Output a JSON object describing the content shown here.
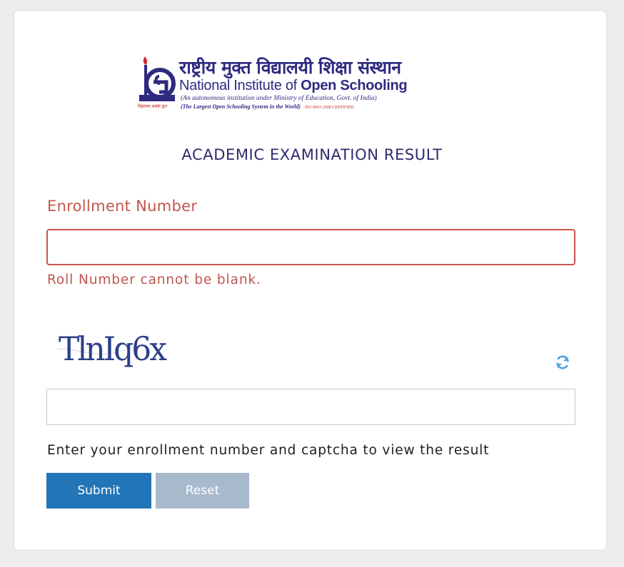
{
  "logo": {
    "title_hindi": "राष्ट्रीय मुक्त विद्यालयी शिक्षा संस्थान",
    "title_english_regular": "National Institute of ",
    "title_english_bold": "Open Schooling",
    "subtitle_1": "(An autonomous institution under Ministry of Education, Govt. of India)",
    "subtitle_2": "(The Largest Open Schooling System in the World)",
    "iso": "ISO 9001:2008 CERTIFIED",
    "emblem_tagline": "विद्यालय सबके द्वार",
    "brand_colors": {
      "navy": "#2d2a80",
      "red": "#c62828"
    }
  },
  "page": {
    "title": "ACADEMIC EXAMINATION RESULT"
  },
  "form": {
    "enrollment_label": "Enrollment Number",
    "enrollment_value": "",
    "enrollment_placeholder": "",
    "error_message": "Roll Number cannot be blank.",
    "captcha_text": "TlnIq6x",
    "captcha_input_value": "",
    "captcha_input_placeholder": "",
    "refresh_icon": "refresh-icon",
    "hint": "Enter your enrollment number and captcha to view the result",
    "submit_label": "Submit",
    "reset_label": "Reset"
  },
  "colors": {
    "error": "#c0564d",
    "primary_button": "#2275b6",
    "secondary_button": "#a9b9cc",
    "title": "#2d2a6e",
    "captcha_ink": "#2c3f8a",
    "refresh_icon": "#4ea6e0"
  }
}
